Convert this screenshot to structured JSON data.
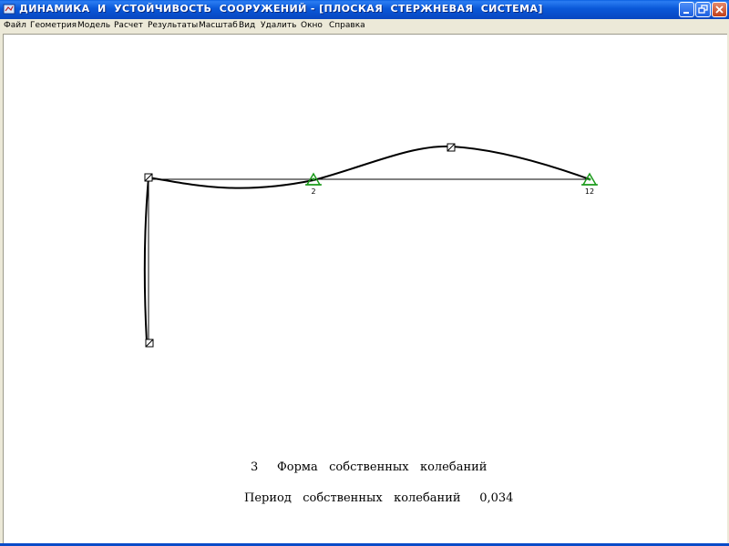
{
  "window": {
    "title": "ДИНАМИКА  И  УСТОЙЧИВОСТЬ  СООРУЖЕНИЙ - [ПЛОСКАЯ  СТЕРЖНЕВАЯ  СИСТЕМА]",
    "title_color": "#ffffff",
    "titlebar_color": "#0a58d8",
    "controls": [
      "minimize-icon",
      "restore-icon",
      "close-icon"
    ]
  },
  "menu": {
    "items": [
      "Файл",
      "Геометрия",
      "Модель",
      "Расчет",
      "Результаты",
      "Масштаб",
      "Вид",
      "Удалить",
      "Окно",
      "Справка"
    ]
  },
  "drawing": {
    "support_labels": [
      "2",
      "12"
    ],
    "support_color": "#1a9a1a"
  },
  "result": {
    "mode_number": "3",
    "mode_title": "Форма   собственных   колебаний",
    "period_label": "Период   собственных   колебаний",
    "period_value": "0,034"
  }
}
